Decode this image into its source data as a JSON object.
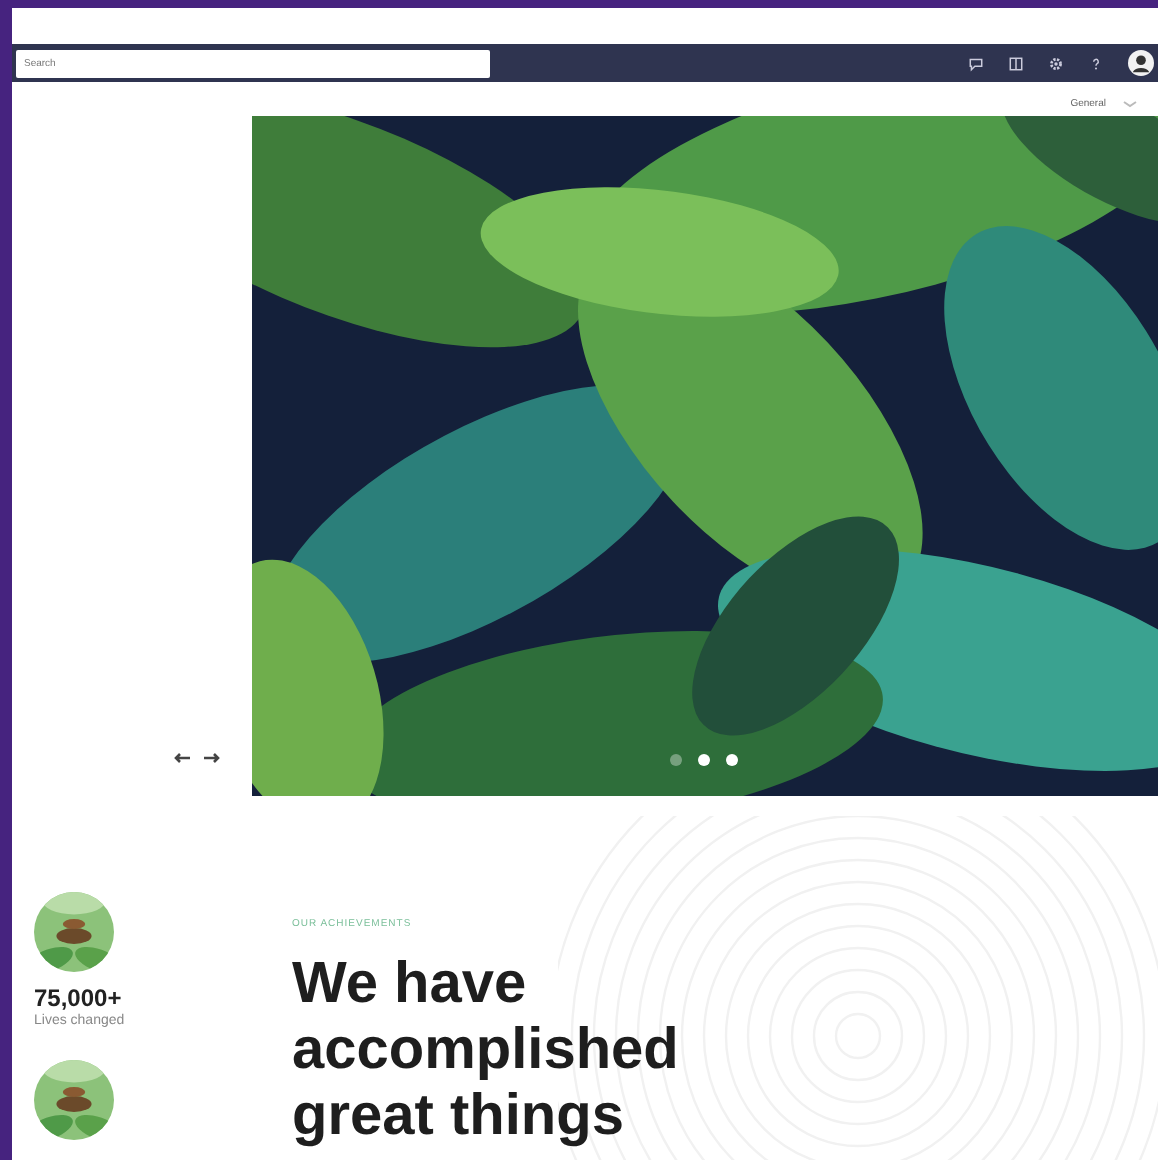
{
  "search": {
    "placeholder": "Search"
  },
  "toolbar": {
    "icons": [
      {
        "kind": "chat"
      },
      {
        "kind": "panel"
      },
      {
        "kind": "settings"
      },
      {
        "kind": "help"
      },
      {
        "kind": "avatar"
      }
    ]
  },
  "menu": {
    "label": "General"
  },
  "hero": {
    "kind": "picture",
    "dots": [
      {
        "selected": false
      },
      {
        "selected": true
      },
      {
        "selected": true
      }
    ]
  },
  "stats": [
    {
      "kind": "picture",
      "value": "75,000+",
      "label": "Lives changed"
    },
    {
      "kind": "picture"
    }
  ],
  "section": {
    "eyebrow": "OUR ACHIEVEMENTS",
    "heading": "We have accomplished great things"
  }
}
